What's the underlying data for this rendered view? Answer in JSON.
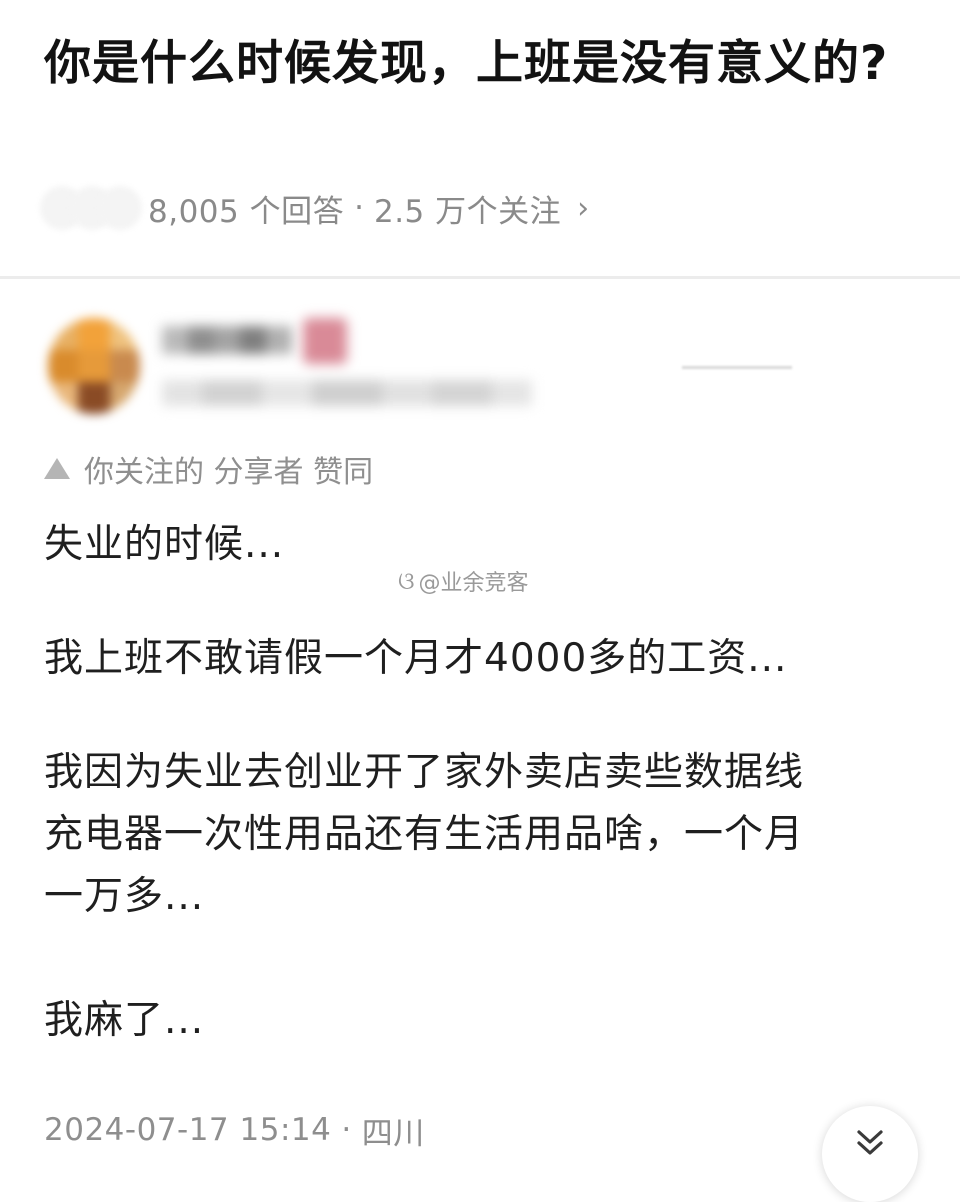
{
  "question": {
    "title": "你是什么时候发现，上班是没有意义的?",
    "answers_count": "8,005 个回答",
    "separator": "·",
    "followers_count": "2.5 万个关注",
    "chevron_glyph": "›"
  },
  "answer": {
    "upvote_note": "你关注的 分享者 赞同",
    "paragraphs": [
      [
        "失业的时候..."
      ],
      [
        "我上班不敢请假一个月才4000多的工资..."
      ],
      [
        "我因为失业去创业开了家外卖店卖些数据线",
        "充电器一次性用品还有生活用品啥，一个月",
        "一万多..."
      ],
      [
        "我麻了..."
      ]
    ],
    "watermark": "@业余竞客",
    "date": "2024-07-17 15:14",
    "location": "四川",
    "meta_separator": "·"
  },
  "colors": {
    "title": "#121212",
    "meta_gray": "#8a8a8a",
    "divider": "#ececec"
  },
  "icons": {
    "upvote": "upvote-triangle-icon",
    "chevron": "chevron-right-icon",
    "watermark": "weibo-icon",
    "expand": "double-chevron-down-icon"
  }
}
